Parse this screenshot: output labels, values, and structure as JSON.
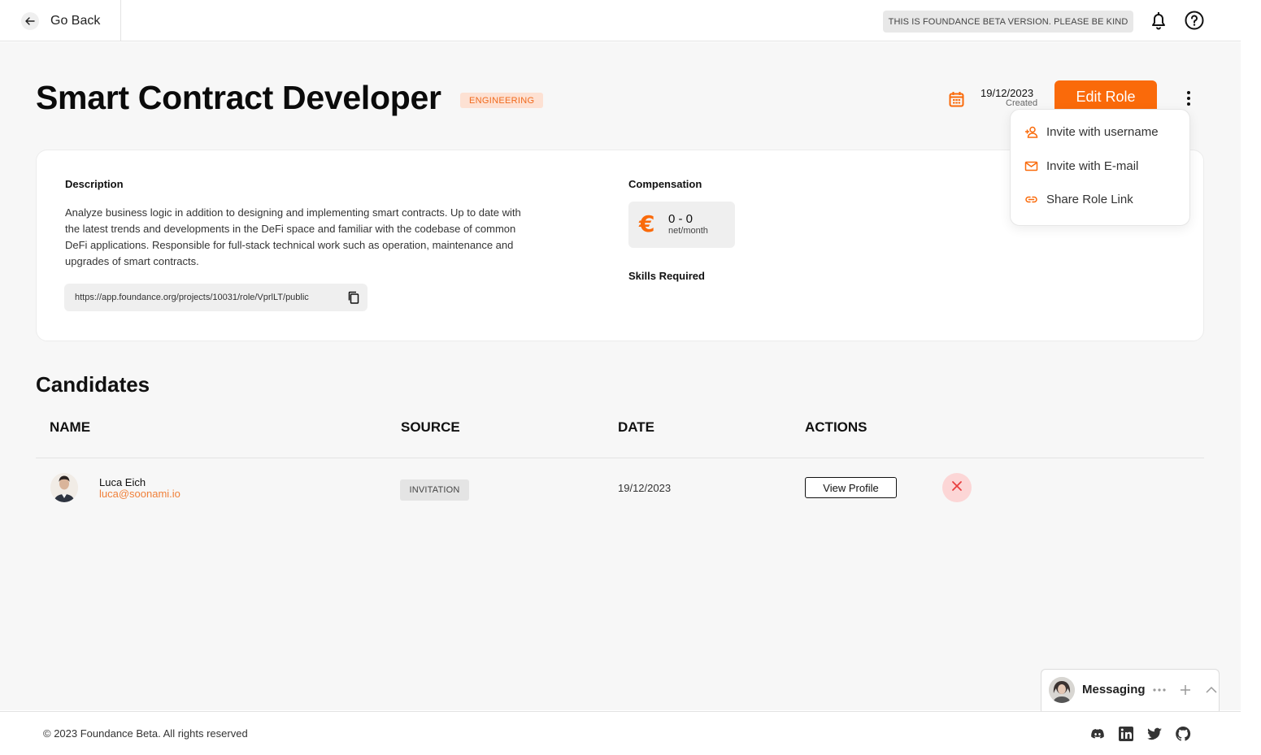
{
  "header": {
    "back_label": "Go Back",
    "beta_notice": "THIS IS FOUNDANCE BETA VERSION. PLEASE BE KIND",
    "icons": [
      "bell-icon",
      "help-icon"
    ]
  },
  "role": {
    "title": "Smart Contract Developer",
    "department": "ENGINEERING",
    "created_date": "19/12/2023",
    "created_label": "Created",
    "edit_label": "Edit Role"
  },
  "menu": {
    "items": [
      {
        "label": "Invite with username",
        "icon": "add-user-icon"
      },
      {
        "label": "Invite with E-mail",
        "icon": "mail-icon"
      },
      {
        "label": "Share Role Link",
        "icon": "link-icon"
      }
    ]
  },
  "details": {
    "description_label": "Description",
    "description": "Analyze business logic in addition to designing and implementing smart contracts. Up to date with the latest trends and developments in the DeFi space and familiar with the codebase of common DeFi applications. Responsible for full-stack technical work such as operation, maintenance and upgrades of smart contracts.",
    "public_link": "https://app.foundance.org/projects/10031/role/VprlLT/public",
    "compensation_label": "Compensation",
    "currency_symbol": "€",
    "compensation_range": "0 - 0",
    "compensation_unit": "net/month",
    "skills_label": "Skills Required"
  },
  "candidates": {
    "title": "Candidates",
    "columns": [
      "NAME",
      "SOURCE",
      "DATE",
      "ACTIONS"
    ],
    "rows": [
      {
        "name": "Luca Eich",
        "email": "luca@soonami.io",
        "source": "INVITATION",
        "date": "19/12/2023",
        "action_label": "View Profile"
      }
    ]
  },
  "messaging": {
    "title": "Messaging"
  },
  "footer": {
    "copyright": "© 2023 Foundance Beta. All rights reserved",
    "social": [
      "discord-icon",
      "linkedin-icon",
      "twitter-icon",
      "github-icon"
    ]
  },
  "colors": {
    "accent": "#fa6a0a",
    "badge_bg": "#fde1d3",
    "email": "#f0803a",
    "remove_bg": "#fcd6d6",
    "remove_fg": "#e94040"
  }
}
